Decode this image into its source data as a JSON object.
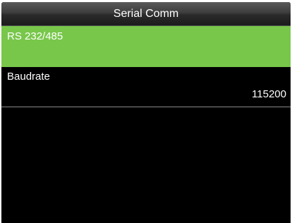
{
  "header": {
    "title": "Serial Comm"
  },
  "menu": {
    "items": [
      {
        "label": "RS 232/485",
        "value": "",
        "selected": true
      },
      {
        "label": "Baudrate",
        "value": "115200",
        "selected": false
      }
    ]
  },
  "colors": {
    "selected_bg": "#78c74b",
    "screen_bg": "#000000",
    "text": "#ffffff"
  }
}
